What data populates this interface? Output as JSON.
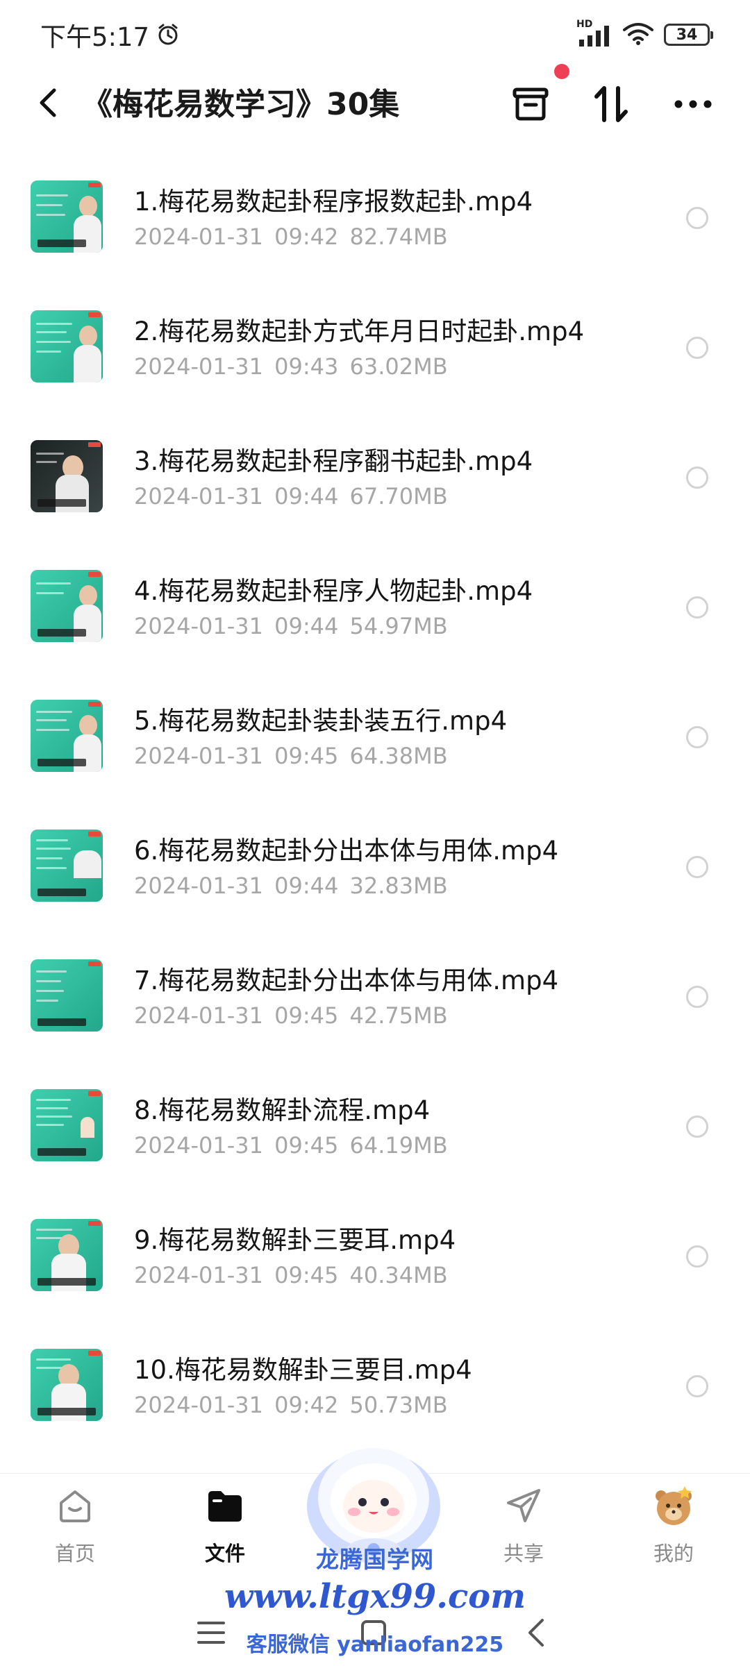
{
  "status_bar": {
    "time": "下午5:17",
    "network": "HD",
    "battery": "34"
  },
  "header": {
    "title": "《梅花易数学习》30集"
  },
  "files": [
    {
      "name": "1.梅花易数起卦程序报数起卦.mp4",
      "date": "2024-01-31",
      "time": "09:42",
      "size": "82.74MB"
    },
    {
      "name": "2.梅花易数起卦方式年月日时起卦.mp4",
      "date": "2024-01-31",
      "time": "09:43",
      "size": "63.02MB"
    },
    {
      "name": "3.梅花易数起卦程序翻书起卦.mp4",
      "date": "2024-01-31",
      "time": "09:44",
      "size": "67.70MB"
    },
    {
      "name": "4.梅花易数起卦程序人物起卦.mp4",
      "date": "2024-01-31",
      "time": "09:44",
      "size": "54.97MB"
    },
    {
      "name": "5.梅花易数起卦装卦装五行.mp4",
      "date": "2024-01-31",
      "time": "09:45",
      "size": "64.38MB"
    },
    {
      "name": "6.梅花易数起卦分出本体与用体.mp4",
      "date": "2024-01-31",
      "time": "09:44",
      "size": "32.83MB"
    },
    {
      "name": "7.梅花易数起卦分出本体与用体.mp4",
      "date": "2024-01-31",
      "time": "09:45",
      "size": "42.75MB"
    },
    {
      "name": "8.梅花易数解卦流程.mp4",
      "date": "2024-01-31",
      "time": "09:45",
      "size": "64.19MB"
    },
    {
      "name": "9.梅花易数解卦三要耳.mp4",
      "date": "2024-01-31",
      "time": "09:45",
      "size": "40.34MB"
    },
    {
      "name": "10.梅花易数解卦三要目.mp4",
      "date": "2024-01-31",
      "time": "09:42",
      "size": "50.73MB"
    }
  ],
  "bottom_nav": {
    "home": "首页",
    "files": "文件",
    "share": "共享",
    "mine": "我的"
  },
  "watermark": {
    "brand": "龙腾国学网",
    "url": "www.ltgx99.com",
    "wechat": "客服微信 yanliaofan225"
  },
  "colors": {
    "accent_red": "#ee3f55",
    "meta_gray": "#a6a6a6",
    "watermark_blue": "#2f58d0"
  }
}
